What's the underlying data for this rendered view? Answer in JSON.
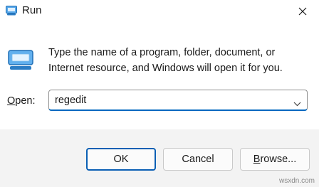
{
  "window": {
    "title": "Run",
    "title_icon": "run-icon",
    "close_icon": "close-icon"
  },
  "main": {
    "icon": "run-icon",
    "description": "Type the name of a program, folder, document, or Internet resource, and Windows will open it for you.",
    "open_label_mnemonic": "O",
    "open_label_rest": "pen:",
    "open_value": "regedit",
    "dropdown_icon": "chevron-down-icon"
  },
  "buttons": {
    "ok_label": "OK",
    "cancel_label": "Cancel",
    "browse_mnemonic": "B",
    "browse_rest": "rowse..."
  },
  "watermark": "wsxdn.com",
  "colors": {
    "accent": "#0067c0",
    "default_button_border": "#0a5fb4",
    "footer_background": "#f3f3f3",
    "icon_blue": "#4a9fe0"
  }
}
